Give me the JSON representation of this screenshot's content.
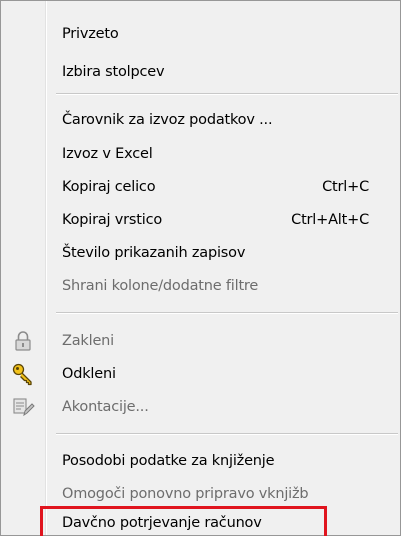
{
  "menu": {
    "group1": [
      {
        "label": "Privzeto",
        "shortcut": "",
        "enabled": true
      },
      {
        "label": "Izbira stolpcev",
        "shortcut": "",
        "enabled": true
      }
    ],
    "group2": [
      {
        "label": "Čarovnik za izvoz podatkov ...",
        "shortcut": "",
        "enabled": true
      },
      {
        "label": "Izvoz v Excel",
        "shortcut": "",
        "enabled": true
      },
      {
        "label": "Kopiraj celico",
        "shortcut": "Ctrl+C",
        "enabled": true
      },
      {
        "label": "Kopiraj vrstico",
        "shortcut": "Ctrl+Alt+C",
        "enabled": true
      },
      {
        "label": "Število prikazanih zapisov",
        "shortcut": "",
        "enabled": true
      },
      {
        "label": "Shrani kolone/dodatne filtre",
        "shortcut": "",
        "enabled": false
      }
    ],
    "group3": [
      {
        "label": "Zakleni",
        "icon": "lock-icon",
        "enabled": false
      },
      {
        "label": "Odkleni",
        "icon": "key-icon",
        "enabled": true
      },
      {
        "label": "Akontacije...",
        "icon": "document-edit-icon",
        "enabled": false
      }
    ],
    "group4": [
      {
        "label": "Posodobi podatke za knjiženje",
        "shortcut": "",
        "enabled": true
      },
      {
        "label": "Omogoči ponovno pripravo vknjižb",
        "shortcut": "",
        "enabled": false
      },
      {
        "label": "Davčno potrjevanje računov",
        "shortcut": "",
        "enabled": true,
        "highlighted": true
      }
    ]
  },
  "colors": {
    "menu_background": "#f0f0f0",
    "disabled_text": "#6d6d6d",
    "highlight_border": "#e0141e"
  }
}
